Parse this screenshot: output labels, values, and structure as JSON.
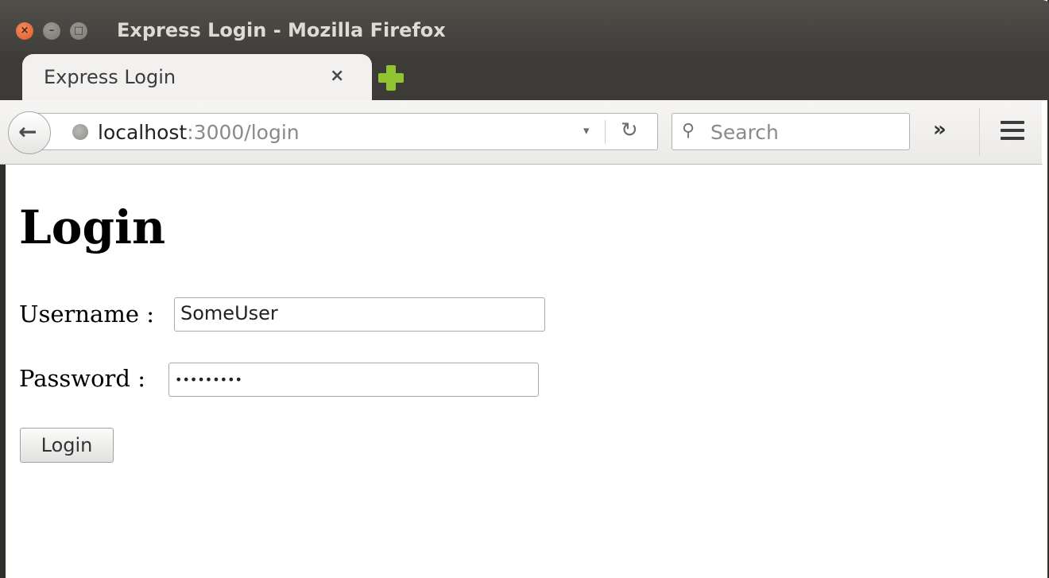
{
  "window": {
    "title": "Express Login - Mozilla Firefox",
    "close_glyph": "×",
    "min_glyph": "–",
    "max_glyph": "□"
  },
  "tabs": [
    {
      "label": "Express Login",
      "close_glyph": "×",
      "active": true
    }
  ],
  "navbar": {
    "back_glyph": "←",
    "url_host": "localhost",
    "url_rest": ":3000/login",
    "dropdown_glyph": "▾",
    "reload_glyph": "↻",
    "search_icon_glyph": "⚲",
    "search_placeholder": "Search",
    "overflow_glyph": "»"
  },
  "page": {
    "title": "Login",
    "username_label": "Username :",
    "username_value": "SomeUser",
    "password_label": "Password :",
    "password_value": "•••••••••",
    "login_button": "Login"
  },
  "colors": {
    "titlebar": "#3e3d39",
    "close_button": "#e05a2c",
    "new_tab_plus": "#8fc32f"
  },
  "icons": [
    "close-icon",
    "minimize-icon",
    "maximize-icon",
    "new-tab-icon",
    "back-arrow-icon",
    "globe-icon",
    "dropdown-icon",
    "reload-icon",
    "search-icon",
    "overflow-icon",
    "hamburger-menu-icon"
  ]
}
